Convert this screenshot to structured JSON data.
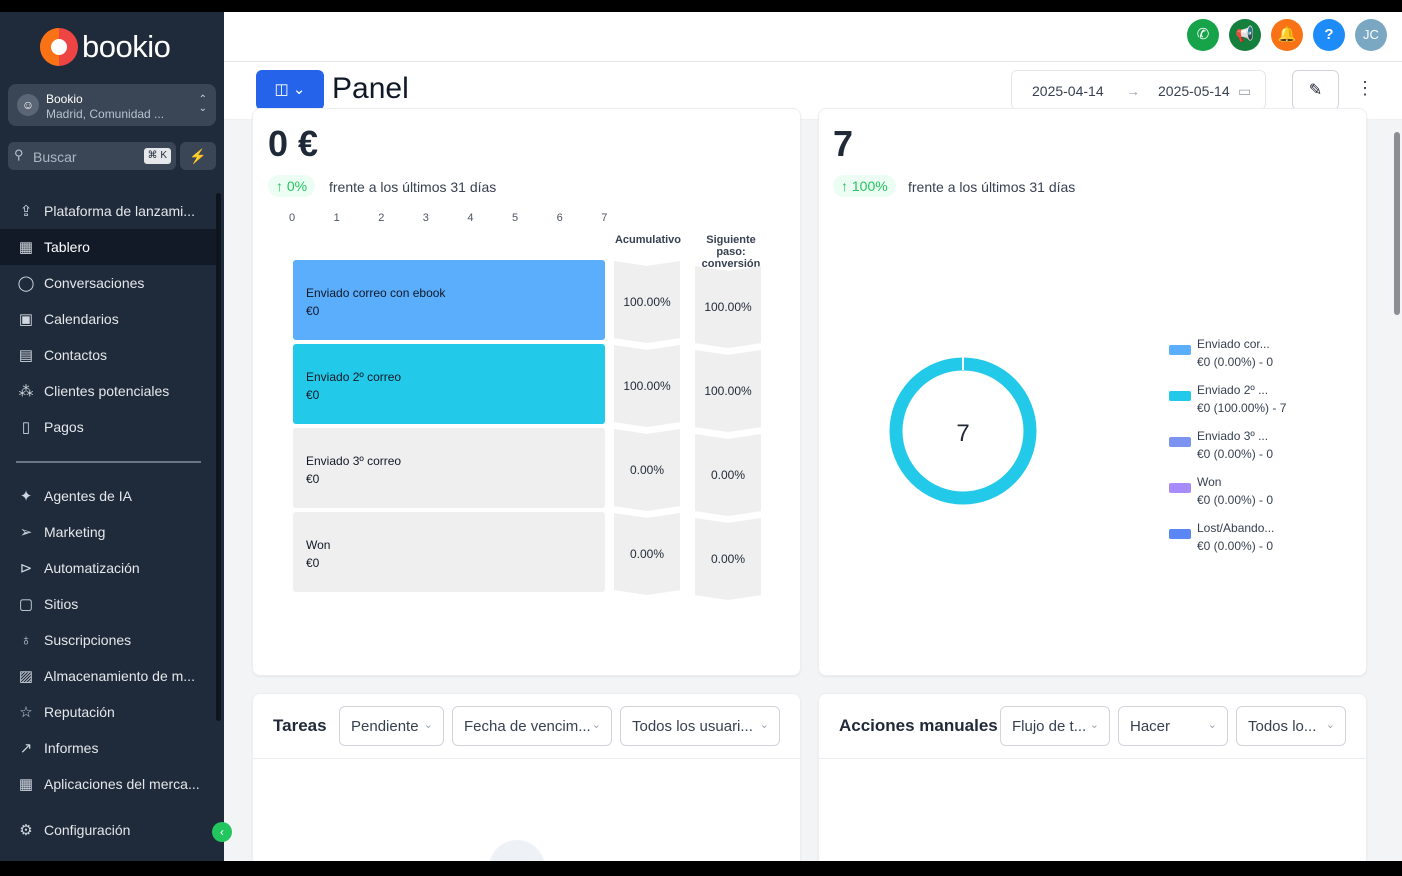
{
  "brand": {
    "name": "bookio"
  },
  "account": {
    "name": "Bookio",
    "location": "Madrid, Comunidad ..."
  },
  "search": {
    "placeholder": "Buscar",
    "shortcut": "⌘ K"
  },
  "sidebar": {
    "items": [
      {
        "label": "Plataforma de lanzami...",
        "icon": "rocket-icon"
      },
      {
        "label": "Tablero",
        "icon": "grid-icon",
        "active": true
      },
      {
        "label": "Conversaciones",
        "icon": "chat-icon"
      },
      {
        "label": "Calendarios",
        "icon": "calendar-icon"
      },
      {
        "label": "Contactos",
        "icon": "contacts-icon"
      },
      {
        "label": "Clientes potenciales",
        "icon": "network-icon"
      },
      {
        "label": "Pagos",
        "icon": "receipt-icon"
      },
      {
        "label": "Agentes de IA",
        "icon": "sparkle-icon"
      },
      {
        "label": "Marketing",
        "icon": "send-icon"
      },
      {
        "label": "Automatización",
        "icon": "automation-icon"
      },
      {
        "label": "Sitios",
        "icon": "sites-icon"
      },
      {
        "label": "Suscripciones",
        "icon": "badge-icon"
      },
      {
        "label": "Almacenamiento de m...",
        "icon": "image-icon"
      },
      {
        "label": "Reputación",
        "icon": "star-icon"
      },
      {
        "label": "Informes",
        "icon": "chart-line-icon"
      },
      {
        "label": "Aplicaciones del merca...",
        "icon": "apps-icon"
      },
      {
        "label": "Configuración",
        "icon": "gear-icon"
      }
    ]
  },
  "topbar": {
    "avatar_initials": "JC",
    "colors": {
      "phone": "#16a34a",
      "megaphone": "#15803d",
      "bell": "#f97316",
      "help": "#1d8cf8",
      "avatar": "#7aa8c2"
    }
  },
  "page": {
    "title": "Panel",
    "date_start": "2025-04-14",
    "date_end": "2025-05-14"
  },
  "funnel_card": {
    "value": "0 €",
    "change": "0%",
    "vs_text": "frente a los últimos 31 días",
    "axis_ticks": [
      "0",
      "1",
      "2",
      "3",
      "4",
      "5",
      "6",
      "7"
    ],
    "col_cumulative": "Acumulativo",
    "col_next": "Siguiente paso: conversión",
    "stages": [
      {
        "name": "Enviado correo con ebook",
        "value": "€0",
        "cumulative": "100.00%",
        "next": "100.00%",
        "color": "#5aaefc"
      },
      {
        "name": "Enviado 2º correo",
        "value": "€0",
        "cumulative": "100.00%",
        "next": "100.00%",
        "color": "#22c9e8"
      },
      {
        "name": "Enviado 3º correo",
        "value": "€0",
        "cumulative": "0.00%",
        "next": "0.00%",
        "color": "#efefef"
      },
      {
        "name": "Won",
        "value": "€0",
        "cumulative": "0.00%",
        "next": "0.00%",
        "color": "#efefef"
      }
    ]
  },
  "donut_card": {
    "value": "7",
    "change": "100%",
    "vs_text": "frente a los últimos 31 días",
    "center": "7",
    "ring_color": "#22c9e8",
    "legend": [
      {
        "name": "Enviado cor...",
        "detail": "€0 (0.00%) - 0",
        "color": "#5aaefc"
      },
      {
        "name": "Enviado 2º ...",
        "detail": "€0 (100.00%) - 7",
        "color": "#22c9e8"
      },
      {
        "name": "Enviado 3º ...",
        "detail": "€0 (0.00%) - 0",
        "color": "#7c93f2"
      },
      {
        "name": "Won",
        "detail": "€0 (0.00%) - 0",
        "color": "#a78bfa"
      },
      {
        "name": "Lost/Abando...",
        "detail": "€0 (0.00%) - 0",
        "color": "#5b86f5"
      }
    ]
  },
  "tasks_card": {
    "title": "Tareas",
    "filters": [
      "Pendiente",
      "Fecha de vencim...",
      "Todos los usuari..."
    ]
  },
  "manual_card": {
    "title": "Acciones manuales",
    "filters": [
      "Flujo de t...",
      "Hacer",
      "Todos lo..."
    ]
  }
}
